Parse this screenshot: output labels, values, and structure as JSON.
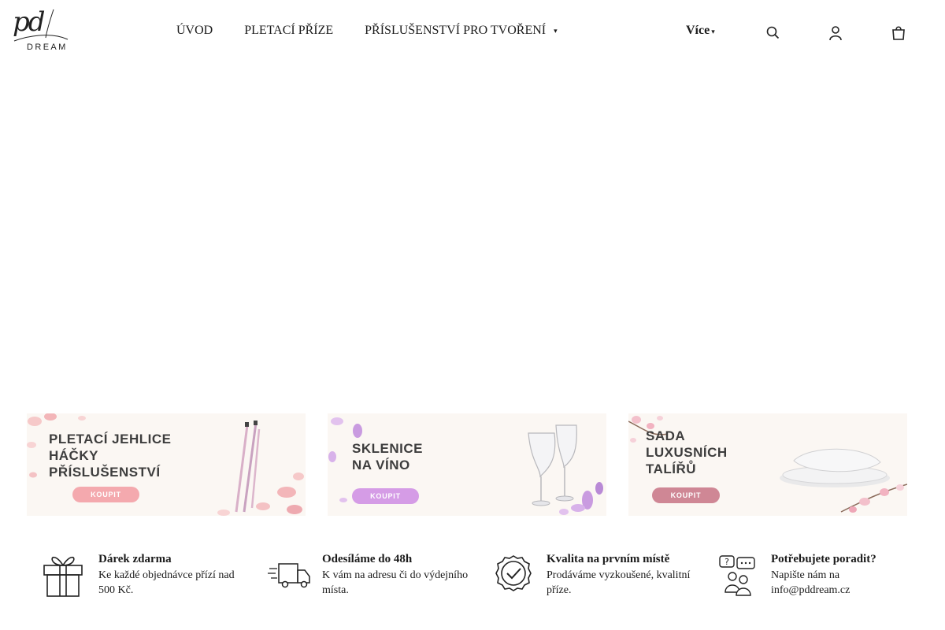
{
  "logo": {
    "mark": "pd",
    "sub": "DREAM"
  },
  "nav": {
    "items": [
      "ÚVOD",
      "PLETACÍ PŘÍZE",
      "PŘÍSLUŠENSTVÍ PRO TVOŘENÍ"
    ],
    "more_label": "Více",
    "caret": "▾"
  },
  "header_icons": [
    "search-icon",
    "user-icon",
    "cart-icon"
  ],
  "banners": [
    {
      "lines": [
        "PLETACÍ JEHLICE",
        "HÁČKY",
        "PŘÍSLUŠENSTVÍ"
      ],
      "button": "KOUPIT",
      "accent": "#f4a9ae"
    },
    {
      "lines": [
        "SKLENICE",
        "NA VÍNO"
      ],
      "button": "KOUPIT",
      "accent": "#d59ce6"
    },
    {
      "lines": [
        "SADA",
        "LUXUSNÍCH",
        "TALÍŘŮ"
      ],
      "button": "KOUPIT",
      "accent": "#cf8795"
    }
  ],
  "features": [
    {
      "icon": "gift-icon",
      "title": "Dárek zdarma",
      "desc": "Ke každé objednávce přízí nad 500 Kč."
    },
    {
      "icon": "truck-icon",
      "title": "Odesíláme do 48h",
      "desc": "K vám na adresu či do výdejního místa."
    },
    {
      "icon": "quality-badge-icon",
      "title": "Kvalita na prvním místě",
      "desc": "Prodáváme vyzkoušené, kvalitní příze."
    },
    {
      "icon": "support-chat-icon",
      "title": "Potřebujete poradit?",
      "desc": "Napište nám na info@pddream.cz"
    }
  ]
}
